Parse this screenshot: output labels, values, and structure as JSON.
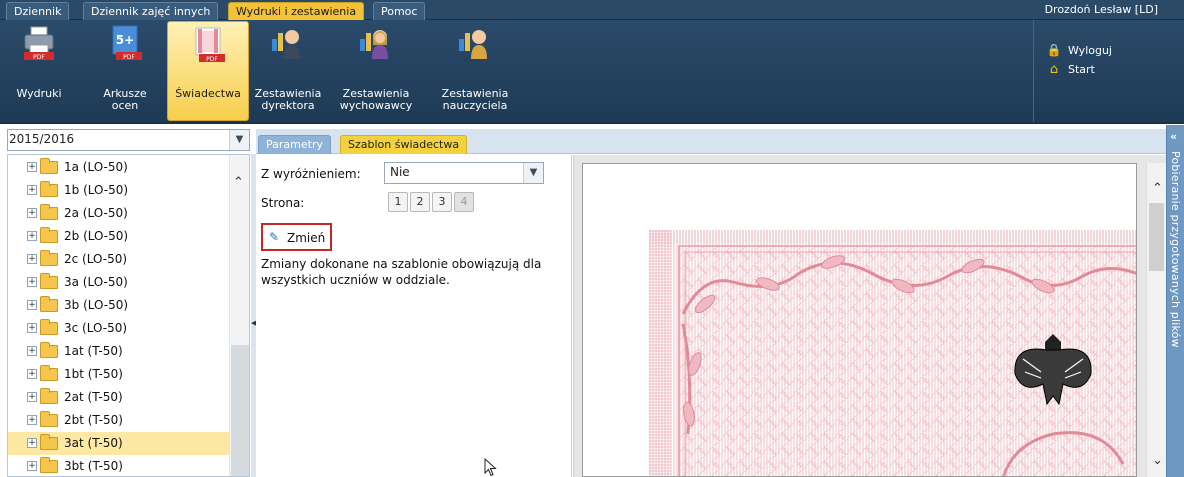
{
  "menu": {
    "tabs": [
      {
        "label": "Dziennik"
      },
      {
        "label": "Dziennik zajęć innych"
      },
      {
        "label": "Wydruki i zestawienia"
      },
      {
        "label": "Pomoc"
      }
    ],
    "user": "Drozdoń Lesław [LD]"
  },
  "ribbon": {
    "items": [
      {
        "label": "Wydruki",
        "icon": "printer-icon",
        "badge": "PDF"
      },
      {
        "label": "Arkusze ocen",
        "icon": "grades-sheet-icon",
        "badge": "PDF",
        "grade": "5+"
      },
      {
        "label": "Świadectwa",
        "icon": "certificate-icon",
        "badge": "PDF"
      },
      {
        "label": "Zestawienia dyrektora",
        "icon": "director-report-icon"
      },
      {
        "label": "Zestawienia wychowawcy",
        "icon": "tutor-report-icon"
      },
      {
        "label": "Zestawienia nauczyciela",
        "icon": "teacher-report-icon"
      }
    ],
    "links": [
      {
        "label": "Wyloguj",
        "icon": "lock-icon"
      },
      {
        "label": "Start",
        "icon": "home-icon"
      }
    ]
  },
  "left": {
    "year": "2015/2016",
    "classes": [
      {
        "label": "1a (LO-50)"
      },
      {
        "label": "1b (LO-50)"
      },
      {
        "label": "2a (LO-50)"
      },
      {
        "label": "2b (LO-50)"
      },
      {
        "label": "2c (LO-50)"
      },
      {
        "label": "3a (LO-50)"
      },
      {
        "label": "3b (LO-50)"
      },
      {
        "label": "3c (LO-50)"
      },
      {
        "label": "1at (T-50)"
      },
      {
        "label": "1bt (T-50)"
      },
      {
        "label": "2at (T-50)"
      },
      {
        "label": "2bt (T-50)"
      },
      {
        "label": "3at (T-50)"
      },
      {
        "label": "3bt (T-50)"
      }
    ],
    "selected_class": "3at (T-50)"
  },
  "tabs": [
    {
      "label": "Parametry"
    },
    {
      "label": "Szablon świadectwa"
    }
  ],
  "params": {
    "distinction_label": "Z wyróżnieniem:",
    "distinction_value": "Nie",
    "page_label": "Strona:",
    "pages": [
      "1",
      "2",
      "3",
      "4"
    ],
    "current_page": "4",
    "change_label": "Zmień",
    "info": "Zmiany dokonane na szablonie obowiązują dla wszystkich uczniów w oddziale."
  },
  "side_panel": {
    "label": "Pobieranie przygotowanych plików"
  },
  "colors": {
    "menubar": "#2a4a68",
    "accent": "#f3c237",
    "certificate_pattern": "#e8a3ad",
    "highlight": "#c92626"
  }
}
